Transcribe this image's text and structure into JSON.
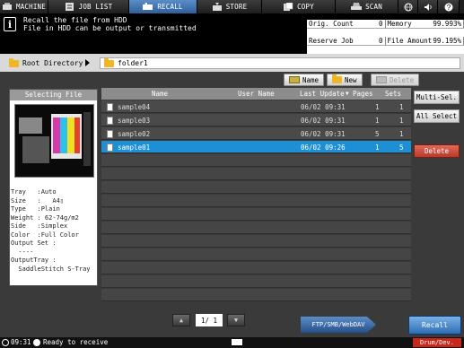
{
  "tabs": [
    {
      "label": "MACHINE",
      "icon": "machine-icon"
    },
    {
      "label": "JOB LIST",
      "icon": "job-list-icon"
    },
    {
      "label": "RECALL",
      "icon": "recall-icon"
    },
    {
      "label": "STORE",
      "icon": "store-icon"
    },
    {
      "label": "COPY",
      "icon": "copy-icon"
    },
    {
      "label": "SCAN",
      "icon": "scan-icon"
    }
  ],
  "message": {
    "line1": "Recall the file from HDD",
    "line2": "File in HDD can be output or transmitted"
  },
  "counters": {
    "orig_count_label": "Orig. Count",
    "orig_count_value": "0",
    "memory_label": "Memory",
    "memory_value": "99.993%",
    "reserve_job_label": "Reserve Job",
    "reserve_job_value": "0",
    "file_amount_label": "File Amount",
    "file_amount_value": "99.195%"
  },
  "breadcrumb": {
    "root": "Root Directory",
    "folder": "folder1"
  },
  "toolbar": {
    "name_label": "Name",
    "new_label": "New",
    "delete_label": "Delete"
  },
  "selecting_file": {
    "header": "Selecting File",
    "attributes": "Tray   :Auto\nSize   :   A4▯\nType   :Plain\nWeight : 62-74g/m2\nSide   :Simplex\nColor  :Full Color\nOutput Set :\n  ----\nOutputTray :\n  SaddleStitch S-Tray"
  },
  "columns": {
    "name": "Name",
    "user_name": "User Name",
    "last_update": "Last Update",
    "pages": "Pages",
    "sets": "Sets"
  },
  "files": [
    {
      "name": "sample04",
      "user": "",
      "date": "06/02 09:31",
      "pages": "1",
      "sets": "1"
    },
    {
      "name": "sample03",
      "user": "",
      "date": "06/02 09:31",
      "pages": "1",
      "sets": "1"
    },
    {
      "name": "sample02",
      "user": "",
      "date": "06/02 09:31",
      "pages": "5",
      "sets": "1"
    },
    {
      "name": "sample01",
      "user": "",
      "date": "06/02 09:26",
      "pages": "1",
      "sets": "5"
    }
  ],
  "side_buttons": {
    "multi_sel": "Multi-Sel.",
    "all_select": "All Select",
    "delete": "Delete"
  },
  "pager": {
    "page": "1/ 1",
    "prev_label": "▲",
    "next_label": "▼"
  },
  "ftp_label": "FTP/SMB/WebDAV",
  "recall_label": "Recall",
  "status": {
    "time": "09:31",
    "state": "Ready to receive",
    "drum": "Drum/Dev."
  },
  "colors": {
    "selected_row": "#1e8fd4",
    "delete_button": "#c8392a",
    "active_tab": "#3a6fb0"
  }
}
